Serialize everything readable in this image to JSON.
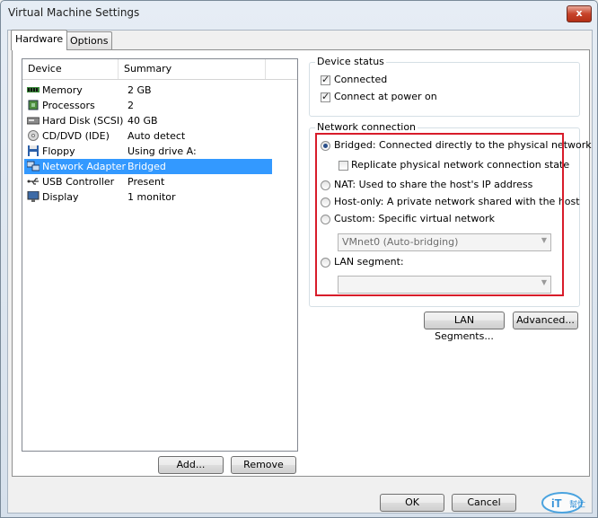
{
  "window": {
    "title": "Virtual Machine Settings",
    "close_glyph": "x"
  },
  "tabs": [
    {
      "label": "Hardware"
    },
    {
      "label": "Options"
    }
  ],
  "device_list": {
    "columns": [
      "Device",
      "Summary"
    ],
    "rows": [
      {
        "name": "Memory",
        "summary": "2 GB",
        "icon": "memory-icon"
      },
      {
        "name": "Processors",
        "summary": "2",
        "icon": "processor-icon"
      },
      {
        "name": "Hard Disk (SCSI)",
        "summary": "40 GB",
        "icon": "hard-disk-icon"
      },
      {
        "name": "CD/DVD (IDE)",
        "summary": "Auto detect",
        "icon": "cd-dvd-icon"
      },
      {
        "name": "Floppy",
        "summary": "Using drive A:",
        "icon": "floppy-icon"
      },
      {
        "name": "Network Adapter",
        "summary": "Bridged",
        "icon": "network-adapter-icon",
        "selected": true
      },
      {
        "name": "USB Controller",
        "summary": "Present",
        "icon": "usb-icon"
      },
      {
        "name": "Display",
        "summary": "1 monitor",
        "icon": "display-icon"
      }
    ]
  },
  "list_buttons": {
    "add": "Add...",
    "remove": "Remove"
  },
  "device_status": {
    "title": "Device status",
    "connected": "Connected",
    "connect_at_power_on": "Connect at power on"
  },
  "network_connection": {
    "title": "Network connection",
    "bridged": "Bridged: Connected directly to the physical network",
    "replicate": "Replicate physical network connection state",
    "nat": "NAT: Used to share the host's IP address",
    "host_only": "Host-only: A private network shared with the host",
    "custom": "Custom: Specific virtual network",
    "custom_select_value": "VMnet0 (Auto-bridging)",
    "lan_segment": "LAN segment:",
    "lan_segment_value": "",
    "selected": "bridged"
  },
  "network_buttons": {
    "lan_segments": "LAN Segments...",
    "advanced": "Advanced..."
  },
  "dialog_buttons": {
    "ok": "OK",
    "cancel": "Cancel"
  },
  "watermark": {
    "text": "iT",
    "subtext": "幫忙"
  },
  "colors": {
    "selection": "#3399ff",
    "highlight_box": "#d81c2a"
  }
}
